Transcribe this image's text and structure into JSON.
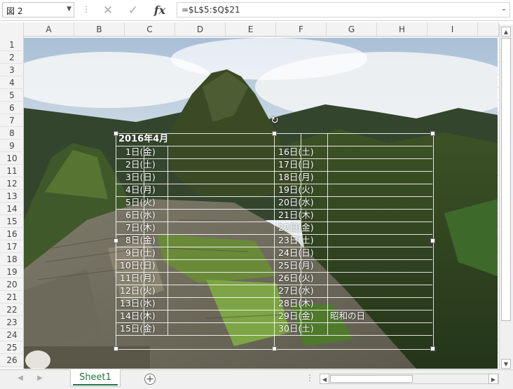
{
  "formula_bar": {
    "name_box": "図 2",
    "separator": "⋮",
    "cancel_glyph": "✕",
    "enter_glyph": "✓",
    "fx_label": "fx",
    "formula": "=$L$5:$Q$21",
    "expand_glyph": "⌄"
  },
  "columns": [
    "A",
    "B",
    "C",
    "D",
    "E",
    "F",
    "G",
    "H",
    "I"
  ],
  "rows": [
    "1",
    "2",
    "3",
    "4",
    "5",
    "6",
    "7",
    "8",
    "9",
    "10",
    "11",
    "12",
    "13",
    "14",
    "15",
    "16",
    "17",
    "18",
    "19",
    "20",
    "21",
    "22",
    "23",
    "24",
    "25",
    "26"
  ],
  "calendar": {
    "title": "2016年4月",
    "left_days": [
      "1日(金)",
      "2日(土)",
      "3日(日)",
      "4日(月)",
      "5日(火)",
      "6日(水)",
      "7日(木)",
      "8日(金)",
      "9日(土)",
      "10日(日)",
      "11日(月)",
      "12日(火)",
      "13日(水)",
      "14日(木)",
      "15日(金)"
    ],
    "right_days": [
      "16日(土)",
      "17日(日)",
      "18日(月)",
      "19日(火)",
      "20日(水)",
      "21日(木)",
      "22日(金)",
      "23日(土)",
      "24日(日)",
      "25日(月)",
      "26日(火)",
      "27日(水)",
      "28日(木)",
      "29日(金)",
      "30日(土)"
    ],
    "holiday_note": "昭和の日",
    "rotate_glyph": "↻"
  },
  "sheet_tabs": {
    "active": "Sheet1",
    "add_glyph": "+",
    "nav_prev": "◀",
    "nav_next": "▶",
    "dots": "⋮"
  },
  "scrollbar": {
    "up": "▲",
    "down": "▼",
    "left": "◀",
    "right": "▶"
  },
  "colors": {
    "accent": "#217346",
    "sheet_tab_text": "#1e7a3a"
  }
}
